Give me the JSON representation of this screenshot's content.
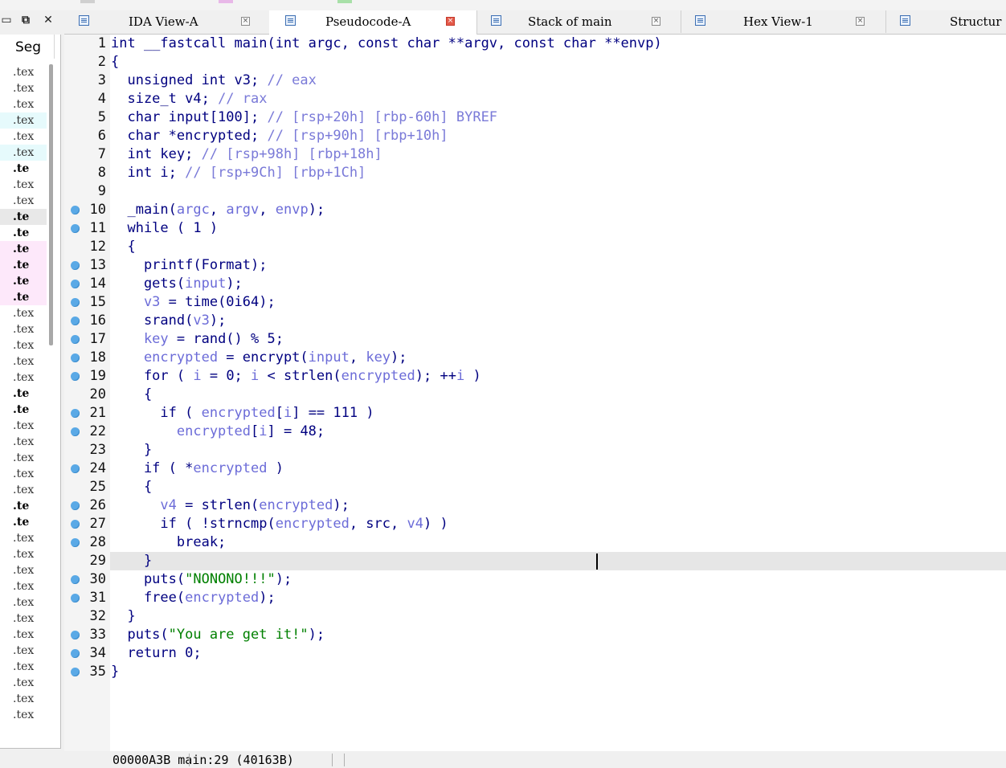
{
  "window_controls": {
    "restore": "⧉",
    "close": "✕",
    "pin": "▭"
  },
  "segments": {
    "header": "Seg",
    "rows": [
      {
        "label": ".tex",
        "bold": false,
        "hl": ""
      },
      {
        "label": ".tex",
        "bold": false,
        "hl": ""
      },
      {
        "label": ".tex",
        "bold": false,
        "hl": ""
      },
      {
        "label": ".tex",
        "bold": false,
        "hl": "cyan"
      },
      {
        "label": ".tex",
        "bold": false,
        "hl": ""
      },
      {
        "label": ".tex",
        "bold": false,
        "hl": "cyan"
      },
      {
        "label": ".te",
        "bold": true,
        "hl": ""
      },
      {
        "label": ".tex",
        "bold": false,
        "hl": ""
      },
      {
        "label": ".tex",
        "bold": false,
        "hl": ""
      },
      {
        "label": ".te",
        "bold": true,
        "hl": "gray"
      },
      {
        "label": ".te",
        "bold": true,
        "hl": ""
      },
      {
        "label": ".te",
        "bold": true,
        "hl": "pink"
      },
      {
        "label": ".te",
        "bold": true,
        "hl": "pink"
      },
      {
        "label": ".te",
        "bold": true,
        "hl": "pink"
      },
      {
        "label": ".te",
        "bold": true,
        "hl": "pink"
      },
      {
        "label": ".tex",
        "bold": false,
        "hl": ""
      },
      {
        "label": ".tex",
        "bold": false,
        "hl": ""
      },
      {
        "label": ".tex",
        "bold": false,
        "hl": ""
      },
      {
        "label": ".tex",
        "bold": false,
        "hl": ""
      },
      {
        "label": ".tex",
        "bold": false,
        "hl": ""
      },
      {
        "label": ".te",
        "bold": true,
        "hl": ""
      },
      {
        "label": ".te",
        "bold": true,
        "hl": ""
      },
      {
        "label": ".tex",
        "bold": false,
        "hl": ""
      },
      {
        "label": ".tex",
        "bold": false,
        "hl": ""
      },
      {
        "label": ".tex",
        "bold": false,
        "hl": ""
      },
      {
        "label": ".tex",
        "bold": false,
        "hl": ""
      },
      {
        "label": ".tex",
        "bold": false,
        "hl": ""
      },
      {
        "label": ".te",
        "bold": true,
        "hl": ""
      },
      {
        "label": ".te",
        "bold": true,
        "hl": ""
      },
      {
        "label": ".tex",
        "bold": false,
        "hl": ""
      },
      {
        "label": ".tex",
        "bold": false,
        "hl": ""
      },
      {
        "label": ".tex",
        "bold": false,
        "hl": ""
      },
      {
        "label": ".tex",
        "bold": false,
        "hl": ""
      },
      {
        "label": ".tex",
        "bold": false,
        "hl": ""
      },
      {
        "label": ".tex",
        "bold": false,
        "hl": ""
      },
      {
        "label": ".tex",
        "bold": false,
        "hl": ""
      },
      {
        "label": ".tex",
        "bold": false,
        "hl": ""
      },
      {
        "label": ".tex",
        "bold": false,
        "hl": ""
      },
      {
        "label": ".tex",
        "bold": false,
        "hl": ""
      },
      {
        "label": ".tex",
        "bold": false,
        "hl": ""
      },
      {
        "label": ".tex",
        "bold": false,
        "hl": ""
      }
    ]
  },
  "tabs": [
    {
      "label": "IDA View-A",
      "active": false,
      "close_red": false
    },
    {
      "label": "Pseudocode-A",
      "active": true,
      "close_red": true
    },
    {
      "label": "Stack of main",
      "active": false,
      "close_red": false
    },
    {
      "label": "Hex View-1",
      "active": false,
      "close_red": false
    },
    {
      "label": "Structur",
      "active": false,
      "close_red": false
    }
  ],
  "code": {
    "current_line": 29,
    "lines": [
      {
        "n": "1",
        "dot": false,
        "parts": [
          [
            "kw",
            "int __fastcall main(int argc, const char **argv, const char **envp)"
          ]
        ]
      },
      {
        "n": "2",
        "dot": false,
        "parts": [
          [
            "kw",
            "{"
          ]
        ]
      },
      {
        "n": "3",
        "dot": false,
        "parts": [
          [
            "kw",
            "  unsigned int v3; "
          ],
          [
            "cm",
            "// eax"
          ]
        ]
      },
      {
        "n": "4",
        "dot": false,
        "parts": [
          [
            "kw",
            "  size_t v4; "
          ],
          [
            "cm",
            "// rax"
          ]
        ]
      },
      {
        "n": "5",
        "dot": false,
        "parts": [
          [
            "kw",
            "  char input[100]; "
          ],
          [
            "cm",
            "// [rsp+20h] [rbp-60h] BYREF"
          ]
        ]
      },
      {
        "n": "6",
        "dot": false,
        "parts": [
          [
            "kw",
            "  char *encrypted; "
          ],
          [
            "cm",
            "// [rsp+90h] [rbp+10h]"
          ]
        ]
      },
      {
        "n": "7",
        "dot": false,
        "parts": [
          [
            "kw",
            "  int key; "
          ],
          [
            "cm",
            "// [rsp+98h] [rbp+18h]"
          ]
        ]
      },
      {
        "n": "8",
        "dot": false,
        "parts": [
          [
            "kw",
            "  int i; "
          ],
          [
            "cm",
            "// [rsp+9Ch] [rbp+1Ch]"
          ]
        ]
      },
      {
        "n": "9",
        "dot": false,
        "parts": [
          [
            "kw",
            ""
          ]
        ]
      },
      {
        "n": "10",
        "dot": true,
        "parts": [
          [
            "id",
            "  _main("
          ],
          [
            "var",
            "argc"
          ],
          [
            "id",
            ", "
          ],
          [
            "var",
            "argv"
          ],
          [
            "id",
            ", "
          ],
          [
            "var",
            "envp"
          ],
          [
            "id",
            ");"
          ]
        ]
      },
      {
        "n": "11",
        "dot": true,
        "parts": [
          [
            "kw",
            "  while ( 1 )"
          ]
        ]
      },
      {
        "n": "12",
        "dot": false,
        "parts": [
          [
            "kw",
            "  {"
          ]
        ]
      },
      {
        "n": "13",
        "dot": true,
        "parts": [
          [
            "id",
            "    printf(Format);"
          ]
        ]
      },
      {
        "n": "14",
        "dot": true,
        "parts": [
          [
            "id",
            "    gets("
          ],
          [
            "var",
            "input"
          ],
          [
            "id",
            ");"
          ]
        ]
      },
      {
        "n": "15",
        "dot": true,
        "parts": [
          [
            "var",
            "    v3"
          ],
          [
            "id",
            " = time(0i64);"
          ]
        ]
      },
      {
        "n": "16",
        "dot": true,
        "parts": [
          [
            "id",
            "    srand("
          ],
          [
            "var",
            "v3"
          ],
          [
            "id",
            ");"
          ]
        ]
      },
      {
        "n": "17",
        "dot": true,
        "parts": [
          [
            "var",
            "    key"
          ],
          [
            "id",
            " = rand() % 5;"
          ]
        ]
      },
      {
        "n": "18",
        "dot": true,
        "parts": [
          [
            "var",
            "    encrypted"
          ],
          [
            "id",
            " = encrypt("
          ],
          [
            "var",
            "input"
          ],
          [
            "id",
            ", "
          ],
          [
            "var",
            "key"
          ],
          [
            "id",
            ");"
          ]
        ]
      },
      {
        "n": "19",
        "dot": true,
        "parts": [
          [
            "kw",
            "    for ( "
          ],
          [
            "var",
            "i"
          ],
          [
            "id",
            " = 0; "
          ],
          [
            "var",
            "i"
          ],
          [
            "id",
            " < strlen("
          ],
          [
            "var",
            "encrypted"
          ],
          [
            "id",
            "); ++"
          ],
          [
            "var",
            "i"
          ],
          [
            "id",
            " )"
          ]
        ]
      },
      {
        "n": "20",
        "dot": false,
        "parts": [
          [
            "kw",
            "    {"
          ]
        ]
      },
      {
        "n": "21",
        "dot": true,
        "parts": [
          [
            "kw",
            "      if ( "
          ],
          [
            "var",
            "encrypted"
          ],
          [
            "id",
            "["
          ],
          [
            "var",
            "i"
          ],
          [
            "id",
            "] == 111 )"
          ]
        ]
      },
      {
        "n": "22",
        "dot": true,
        "parts": [
          [
            "var",
            "        encrypted"
          ],
          [
            "id",
            "["
          ],
          [
            "var",
            "i"
          ],
          [
            "id",
            "] = 48;"
          ]
        ]
      },
      {
        "n": "23",
        "dot": false,
        "parts": [
          [
            "kw",
            "    }"
          ]
        ]
      },
      {
        "n": "24",
        "dot": true,
        "parts": [
          [
            "kw",
            "    if ( *"
          ],
          [
            "var",
            "encrypted"
          ],
          [
            "id",
            " )"
          ]
        ]
      },
      {
        "n": "25",
        "dot": false,
        "parts": [
          [
            "kw",
            "    {"
          ]
        ]
      },
      {
        "n": "26",
        "dot": true,
        "parts": [
          [
            "var",
            "      v4"
          ],
          [
            "id",
            " = strlen("
          ],
          [
            "var",
            "encrypted"
          ],
          [
            "id",
            ");"
          ]
        ]
      },
      {
        "n": "27",
        "dot": true,
        "parts": [
          [
            "kw",
            "      if ( !strncmp("
          ],
          [
            "var",
            "encrypted"
          ],
          [
            "id",
            ", src, "
          ],
          [
            "var",
            "v4"
          ],
          [
            "id",
            ") )"
          ]
        ]
      },
      {
        "n": "28",
        "dot": true,
        "parts": [
          [
            "kw",
            "        break;"
          ]
        ]
      },
      {
        "n": "29",
        "dot": false,
        "parts": [
          [
            "kw",
            "    }"
          ]
        ]
      },
      {
        "n": "30",
        "dot": true,
        "parts": [
          [
            "id",
            "    puts("
          ],
          [
            "str",
            "\"NONONO!!!\""
          ],
          [
            "id",
            ");"
          ]
        ]
      },
      {
        "n": "31",
        "dot": true,
        "parts": [
          [
            "id",
            "    free("
          ],
          [
            "var",
            "encrypted"
          ],
          [
            "id",
            ");"
          ]
        ]
      },
      {
        "n": "32",
        "dot": false,
        "parts": [
          [
            "kw",
            "  }"
          ]
        ]
      },
      {
        "n": "33",
        "dot": true,
        "parts": [
          [
            "id",
            "  puts("
          ],
          [
            "str",
            "\"You are get it!\""
          ],
          [
            "id",
            ");"
          ]
        ]
      },
      {
        "n": "34",
        "dot": true,
        "parts": [
          [
            "kw",
            "  return 0;"
          ]
        ]
      },
      {
        "n": "35",
        "dot": true,
        "parts": [
          [
            "kw",
            "}"
          ]
        ]
      }
    ]
  },
  "status": {
    "text": "00000A3B main:29 (40163B)"
  },
  "colors": {
    "keyword": "#000080",
    "variable": "#6c6cd8",
    "comment": "#7a7ad8",
    "string": "#008000",
    "breakpoint_dot": "#5aa9e6",
    "current_line_bg": "#e6e6e6"
  },
  "icons": {
    "tab_icon": "document-lines-icon",
    "tab_close": "close-x-icon",
    "line_dot": "breakpoint-dot-icon"
  }
}
